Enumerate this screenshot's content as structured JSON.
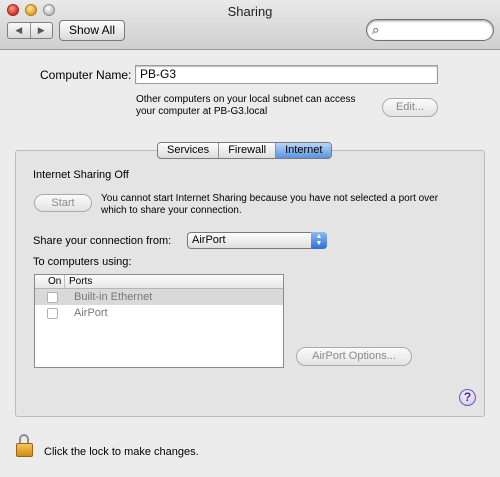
{
  "window": {
    "title": "Sharing",
    "nav_back": "◀",
    "nav_forward": "▶",
    "show_all_label": "Show All",
    "search_icon_glyph": "⌕",
    "search_placeholder": ""
  },
  "computer": {
    "name_label": "Computer Name:",
    "name_value": "PB-G3",
    "info_line1": "Other computers on your local subnet can access",
    "info_line2": "your computer at PB-G3.local",
    "edit_label": "Edit..."
  },
  "tabs": [
    {
      "label": "Services",
      "active": false
    },
    {
      "label": "Firewall",
      "active": false
    },
    {
      "label": "Internet",
      "active": true
    }
  ],
  "internet": {
    "status": "Internet Sharing Off",
    "start_label": "Start",
    "message_line1": "You cannot start Internet Sharing because you have not selected a port over",
    "message_line2": "which to share your connection.",
    "share_from_label": "Share your connection from:",
    "share_from_value": "AirPort",
    "to_computers_label": "To computers using:",
    "columns": [
      "On",
      "Ports"
    ],
    "ports": [
      {
        "name": "Built-in Ethernet",
        "checked": false
      },
      {
        "name": "AirPort",
        "checked": false
      }
    ],
    "airport_options_label": "AirPort Options..."
  },
  "help_glyph": "?",
  "lock_text": "Click the lock to make changes.",
  "icons": [
    "close-button",
    "minimize-button",
    "zoom-button",
    "search-icon",
    "help-icon",
    "lock-icon",
    "popup-arrows-icon"
  ],
  "colors": {
    "tab_active": "#5a94df",
    "popup_arrows": "#2c6fd4",
    "lock_body": "#d18a1a"
  }
}
